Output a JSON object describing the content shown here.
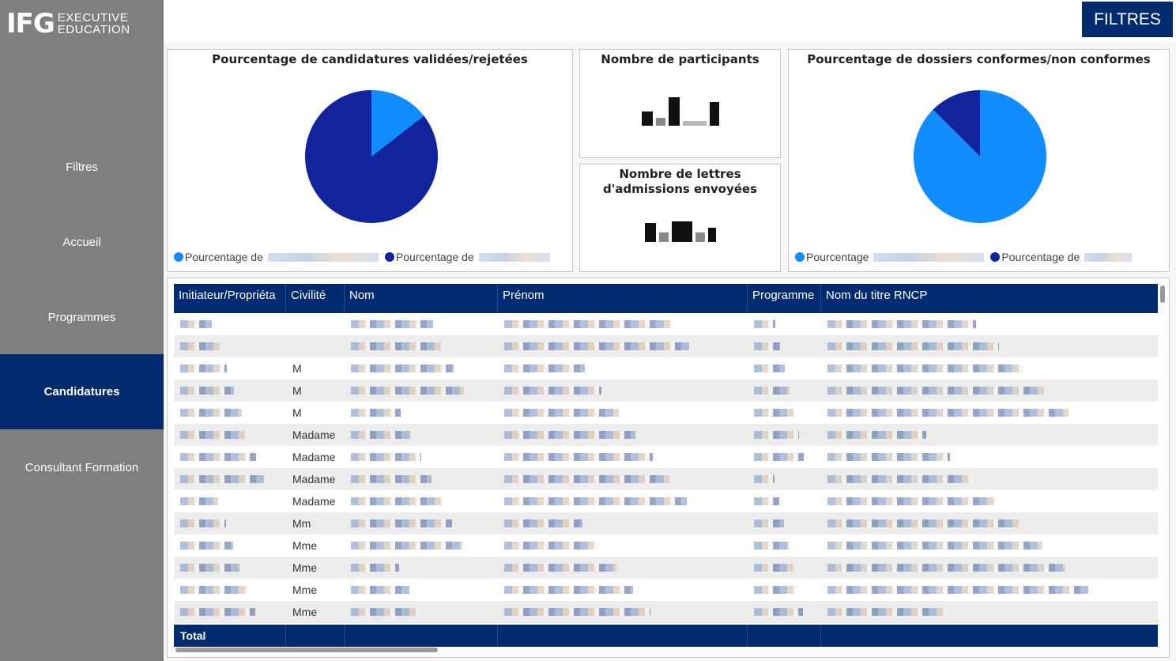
{
  "logo": {
    "mark": "IFG",
    "line1": "EXECUTIVE",
    "line2": "EDUCATION"
  },
  "nav": [
    {
      "label": "Filtres",
      "active": false
    },
    {
      "label": "Accueil",
      "active": false
    },
    {
      "label": "Programmes",
      "active": false
    },
    {
      "label": "Candidatures",
      "active": true
    },
    {
      "label": "Consultant Formation",
      "active": false
    }
  ],
  "topbar": {
    "filters_button": "FILTRES"
  },
  "colors": {
    "navy": "#002b6e",
    "pie_dark": "#12239e",
    "pie_light": "#118dff",
    "sidebar": "#7f7f7f"
  },
  "panels": {
    "candidatures": {
      "title": "Pourcentage de candidatures validées/rejetées",
      "legend": [
        "Pourcentage de",
        "Pourcentage de"
      ]
    },
    "participants": {
      "title": "Nombre de participants"
    },
    "lettres": {
      "title": "Nombre de lettres d'admissions envoyées"
    },
    "dossiers": {
      "title": "Pourcentage de dossiers conformes/non conformes",
      "legend": [
        "Pourcentage",
        "Pourcentage de"
      ]
    }
  },
  "table": {
    "columns": [
      "Initiateur/Propriéta",
      "Civilité",
      "Nom",
      "Prénom",
      "Programme",
      "Nom du titre RNCP"
    ],
    "civilite": [
      "",
      "",
      "M",
      "M",
      "M",
      "Madame",
      "Madame",
      "Madame",
      "Madame",
      "Mm",
      "Mme",
      "Mme",
      "Mme",
      "Mme"
    ],
    "total_label": "Total"
  },
  "chart_data": [
    {
      "type": "pie",
      "title": "Pourcentage de candidatures validées/rejetées",
      "series": [
        {
          "name": "Pourcentage de",
          "value": 14.5
        },
        {
          "name": "Pourcentage de",
          "value": 85.5
        }
      ],
      "colors": [
        "#118dff",
        "#12239e"
      ],
      "legend_position": "bottom-left"
    },
    {
      "type": "pie",
      "title": "Pourcentage de dossiers conformes/non conformes",
      "series": [
        {
          "name": "Pourcentage",
          "value": 87.5
        },
        {
          "name": "Pourcentage de",
          "value": 12.5
        }
      ],
      "colors": [
        "#118dff",
        "#12239e"
      ],
      "legend_position": "bottom-left"
    }
  ]
}
